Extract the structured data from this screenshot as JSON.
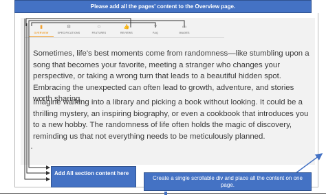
{
  "banner": {
    "text": "Please add all the pages' content to the Overview page."
  },
  "tabs": [
    {
      "label": "OVERVIEW",
      "icon": "document-icon",
      "glyph": "▮",
      "active": true
    },
    {
      "label": "SPECIFICATIONS",
      "icon": "specifications-icon",
      "glyph": "⚙",
      "active": false
    },
    {
      "label": "FEATURES",
      "icon": "star-icon",
      "glyph": "☆",
      "active": false
    },
    {
      "label": "REVIEWS",
      "icon": "thumbs-up-icon",
      "glyph": "👍",
      "active": false
    },
    {
      "label": "FAQ",
      "icon": "question-icon",
      "glyph": "?",
      "active": false
    },
    {
      "label": "IMAGES",
      "icon": "image-icon",
      "glyph": "▭",
      "active": false
    }
  ],
  "content": {
    "paragraph1": "Sometimes, life's best moments come from randomness—like stumbling upon a song that becomes your favorite, meeting a stranger who changes your perspective, or taking a wrong turn that leads to a beautiful hidden spot. Embracing the unexpected can often lead to growth, adventure, and stories worth sharing.",
    "paragraph2": "Imagine walking into a library and picking a book without looking. It could be a thrilling mystery, an inspiring biography, or even a cookbook that introduces you to a new hobby. The randomness of life often holds the magic of discovery, reminding us that not everything needs to be meticulously planned."
  },
  "callouts": {
    "left": "Add All section content here",
    "right": "Create a single scrollable div and place all the content on one page."
  },
  "colors": {
    "callout_blue": "#4472c4",
    "active_tab": "#f0a030",
    "content_bg": "#f2f2f2"
  }
}
